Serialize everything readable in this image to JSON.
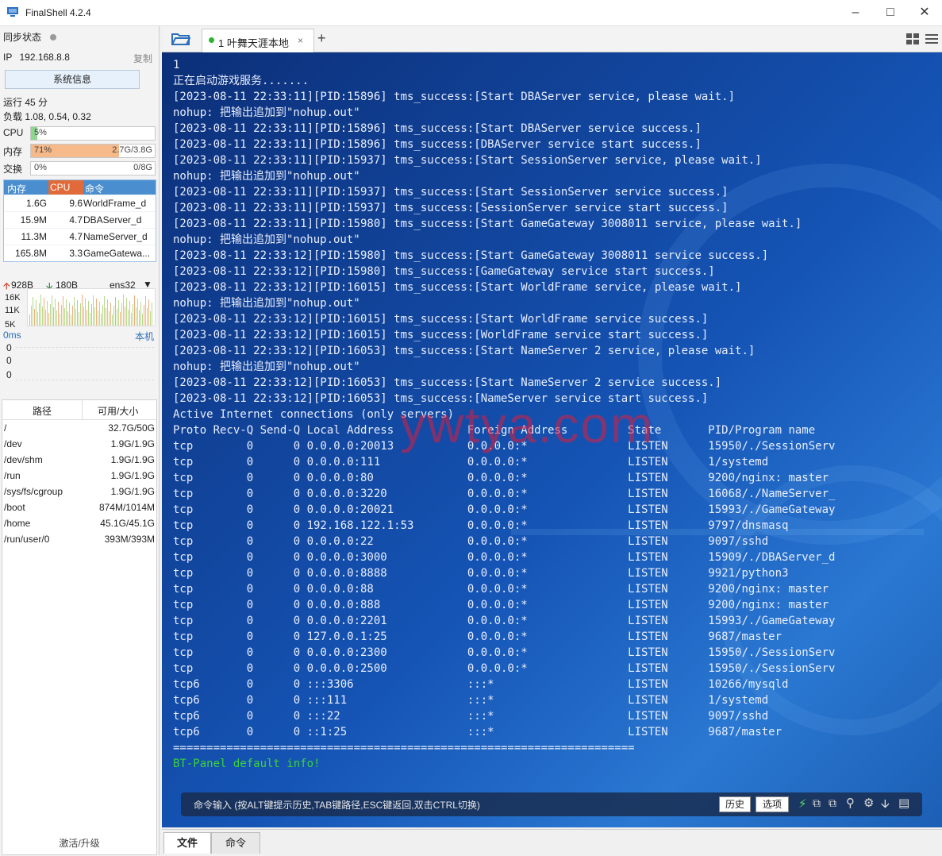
{
  "app": {
    "title": "FinalShell 4.2.4"
  },
  "sync": {
    "label": "同步状态"
  },
  "ip": {
    "label": "IP",
    "value": "192.168.8.8",
    "copy": "复制"
  },
  "sysinfo_btn": "系统信息",
  "uptime": "运行 45 分",
  "load": "负载 1.08, 0.54, 0.32",
  "cpu": {
    "label": "CPU",
    "text": "5%",
    "percent": 5,
    "color": "#8fd68f"
  },
  "mem": {
    "label": "内存",
    "text": "71%",
    "right": "2.7G/3.8G",
    "percent": 71,
    "color": "#f5b98a"
  },
  "swap": {
    "label": "交换",
    "text": "0%",
    "right": "0/8G",
    "percent": 0
  },
  "proc_header": {
    "mem": "内存",
    "cpu": "CPU",
    "cmd": "命令"
  },
  "processes": [
    {
      "mem": "1.6G",
      "cpu": "9.6",
      "cmd": "WorldFrame_d"
    },
    {
      "mem": "15.9M",
      "cpu": "4.7",
      "cmd": "DBAServer_d"
    },
    {
      "mem": "11.3M",
      "cpu": "4.7",
      "cmd": "NameServer_d"
    },
    {
      "mem": "165.8M",
      "cpu": "3.3",
      "cmd": "GameGatewa..."
    }
  ],
  "net": {
    "up": "928B",
    "down": "180B",
    "iface": "ens32",
    "y_labels": [
      "16K",
      "11K",
      "5K"
    ]
  },
  "latency": {
    "label": "0ms",
    "host": "本机",
    "values": [
      "0",
      "0",
      "0"
    ]
  },
  "disk_header": {
    "path": "路径",
    "size": "可用/大小"
  },
  "disks": [
    {
      "path": "/",
      "size": "32.7G/50G"
    },
    {
      "path": "/dev",
      "size": "1.9G/1.9G"
    },
    {
      "path": "/dev/shm",
      "size": "1.9G/1.9G"
    },
    {
      "path": "/run",
      "size": "1.9G/1.9G"
    },
    {
      "path": "/sys/fs/cgroup",
      "size": "1.9G/1.9G"
    },
    {
      "path": "/boot",
      "size": "874M/1014M"
    },
    {
      "path": "/home",
      "size": "45.1G/45.1G"
    },
    {
      "path": "/run/user/0",
      "size": "393M/393M"
    }
  ],
  "activate": "激活/升级",
  "tab": {
    "label": "1 叶舞天涯本地"
  },
  "terminal_lines": [
    "1",
    "正在启动游戏服务.......",
    "[2023-08-11 22:33:11][PID:15896] tms_success:[Start DBAServer service, please wait.]",
    "nohup: 把输出追加到\"nohup.out\"",
    "[2023-08-11 22:33:11][PID:15896] tms_success:[Start DBAServer service success.]",
    "[2023-08-11 22:33:11][PID:15896] tms_success:[DBAServer service start success.]",
    "[2023-08-11 22:33:11][PID:15937] tms_success:[Start SessionServer service, please wait.]",
    "nohup: 把输出追加到\"nohup.out\"",
    "[2023-08-11 22:33:11][PID:15937] tms_success:[Start SessionServer service success.]",
    "[2023-08-11 22:33:11][PID:15937] tms_success:[SessionServer service start success.]",
    "[2023-08-11 22:33:11][PID:15980] tms_success:[Start GameGateway 3008011 service, please wait.]",
    "nohup: 把输出追加到\"nohup.out\"",
    "[2023-08-11 22:33:12][PID:15980] tms_success:[Start GameGateway 3008011 service success.]",
    "[2023-08-11 22:33:12][PID:15980] tms_success:[GameGateway service start success.]",
    "[2023-08-11 22:33:12][PID:16015] tms_success:[Start WorldFrame service, please wait.]",
    "nohup: 把输出追加到\"nohup.out\"",
    "[2023-08-11 22:33:12][PID:16015] tms_success:[Start WorldFrame service success.]",
    "[2023-08-11 22:33:12][PID:16015] tms_success:[WorldFrame service start success.]",
    "[2023-08-11 22:33:12][PID:16053] tms_success:[Start NameServer 2 service, please wait.]",
    "nohup: 把输出追加到\"nohup.out\"",
    "[2023-08-11 22:33:12][PID:16053] tms_success:[Start NameServer 2 service success.]",
    "[2023-08-11 22:33:12][PID:16053] tms_success:[NameServer service start success.]",
    "Active Internet connections (only servers)",
    "Proto Recv-Q Send-Q Local Address           Foreign Address         State       PID/Program name",
    "tcp        0      0 0.0.0.0:20013           0.0.0.0:*               LISTEN      15950/./SessionServ",
    "tcp        0      0 0.0.0.0:111             0.0.0.0:*               LISTEN      1/systemd",
    "tcp        0      0 0.0.0.0:80              0.0.0.0:*               LISTEN      9200/nginx: master",
    "tcp        0      0 0.0.0.0:3220            0.0.0.0:*               LISTEN      16068/./NameServer_",
    "tcp        0      0 0.0.0.0:20021           0.0.0.0:*               LISTEN      15993/./GameGateway",
    "tcp        0      0 192.168.122.1:53        0.0.0.0:*               LISTEN      9797/dnsmasq",
    "tcp        0      0 0.0.0.0:22              0.0.0.0:*               LISTEN      9097/sshd",
    "tcp        0      0 0.0.0.0:3000            0.0.0.0:*               LISTEN      15909/./DBAServer_d",
    "tcp        0      0 0.0.0.0:8888            0.0.0.0:*               LISTEN      9921/python3",
    "tcp        0      0 0.0.0.0:88              0.0.0.0:*               LISTEN      9200/nginx: master",
    "tcp        0      0 0.0.0.0:888             0.0.0.0:*               LISTEN      9200/nginx: master",
    "tcp        0      0 0.0.0.0:2201            0.0.0.0:*               LISTEN      15993/./GameGateway",
    "tcp        0      0 127.0.0.1:25            0.0.0.0:*               LISTEN      9687/master",
    "tcp        0      0 0.0.0.0:2300            0.0.0.0:*               LISTEN      15950/./SessionServ",
    "tcp        0      0 0.0.0.0:2500            0.0.0.0:*               LISTEN      15950/./SessionServ",
    "tcp6       0      0 :::3306                 :::*                    LISTEN      10266/mysqld",
    "tcp6       0      0 :::111                  :::*                    LISTEN      1/systemd",
    "tcp6       0      0 :::22                   :::*                    LISTEN      9097/sshd",
    "tcp6       0      0 ::1:25                  :::*                    LISTEN      9687/master",
    "=====================================================================",
    "BT-Panel default info!"
  ],
  "watermark": "ywtya.com",
  "cmd": {
    "placeholder": "命令输入 (按ALT键提示历史,TAB键路径,ESC键返回,双击CTRL切换)",
    "history": "历史",
    "options": "选项"
  },
  "bottom_tabs": {
    "files": "文件",
    "cmd": "命令"
  }
}
